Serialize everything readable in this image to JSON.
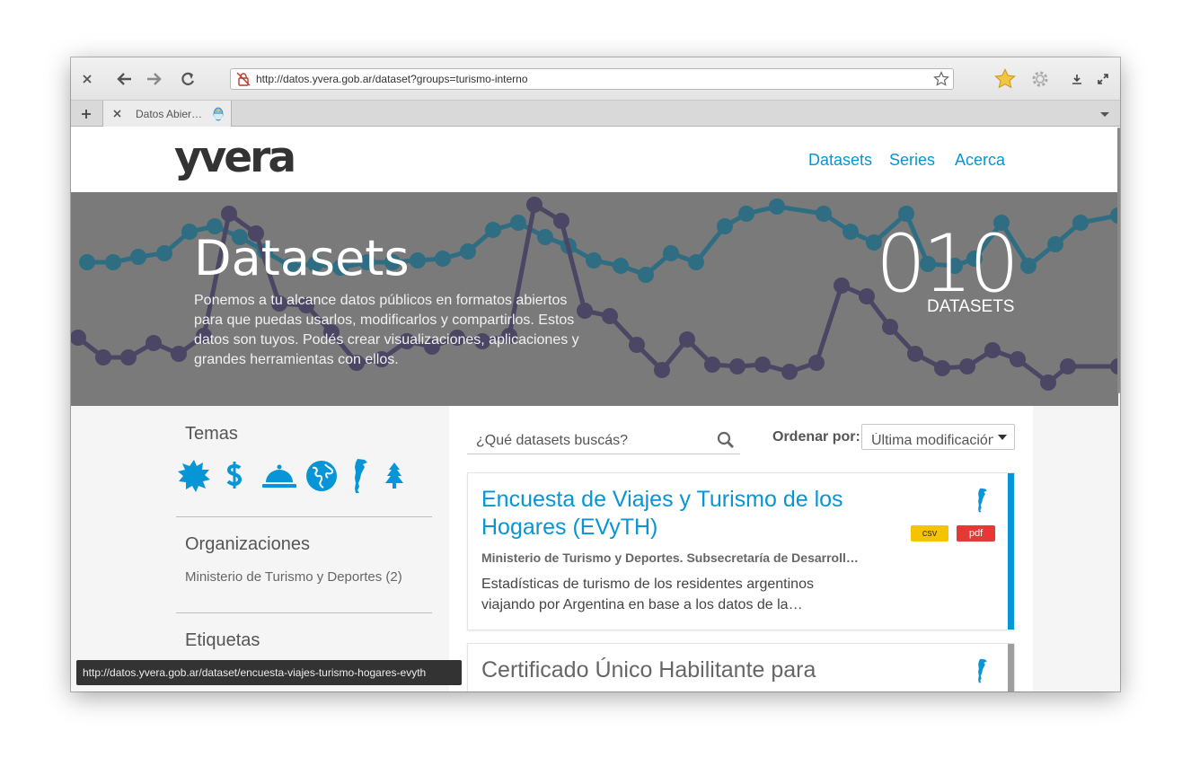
{
  "browser": {
    "url": "http://datos.yvera.gob.ar/dataset?groups=turismo-interno",
    "tab_title": "Datos Abier…",
    "status_url": "http://datos.yvera.gob.ar/dataset/encuesta-viajes-turismo-hogares-evyth"
  },
  "site": {
    "logo": "yvera",
    "nav": [
      "Datasets",
      "Series",
      "Acerca"
    ]
  },
  "hero": {
    "title": "Datasets",
    "description": "Ponemos a tu alcance datos públicos en formatos abiertos para que puedas usarlos, modificarlos y compartirlos. Estos datos son tuyos. Podés crear visualizaciones, aplicaciones y grandes herramientas con ellos.",
    "count": "010",
    "count_label": "DATASETS"
  },
  "sidebar": {
    "themes_heading": "Temas",
    "themes_icons": [
      "sun-icon",
      "dollar-icon",
      "service-bell-icon",
      "globe-icon",
      "argentina-map-icon",
      "tree-icon"
    ],
    "orgs_heading": "Organizaciones",
    "orgs": [
      "Ministerio de Turismo y Deportes (2)"
    ],
    "tags_heading": "Etiquetas"
  },
  "search": {
    "placeholder": "¿Qué datasets buscás?",
    "sort_label": "Ordenar por:",
    "sort_value": "Última modificación"
  },
  "datasets": [
    {
      "title": "Encuesta de Viajes y Turismo de los Hogares (EVyTH)",
      "org": "Ministerio de Turismo y Deportes. Subsecretaría de Desarroll…",
      "description": "Estadísticas de turismo de los residentes argentinos viajando por Argentina en base a los datos de la…",
      "formats": [
        "csv",
        "pdf"
      ],
      "accent": "#0695d6"
    },
    {
      "title": "Certificado Único Habilitante para",
      "accent": "#9e9e9e"
    }
  ],
  "colors": {
    "brand_blue": "#0695d6",
    "csv_badge": "#f5c400",
    "pdf_badge": "#e53935"
  }
}
